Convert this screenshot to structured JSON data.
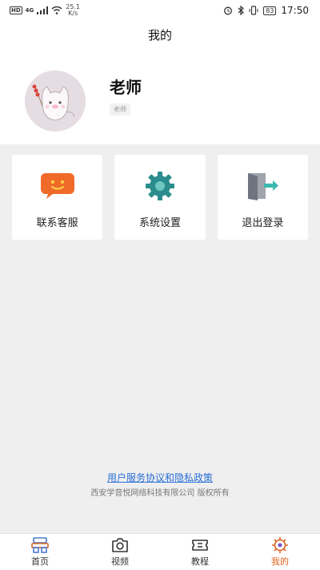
{
  "status_bar": {
    "hd": "HD",
    "network": "4G",
    "speed_value": "25.1",
    "speed_unit": "K/s",
    "battery": "83",
    "time": "17:50"
  },
  "header": {
    "title": "我的"
  },
  "profile": {
    "name": "老师",
    "role_tag": "老师"
  },
  "actions": [
    {
      "label": "联系客服",
      "icon": "customer-service-icon"
    },
    {
      "label": "系统设置",
      "icon": "gear-icon"
    },
    {
      "label": "退出登录",
      "icon": "logout-icon"
    }
  ],
  "footer": {
    "policy_link": "用户服务协议和隐私政策",
    "copyright": "西安学音悦网络科技有限公司 版权所有"
  },
  "tabbar": {
    "active": "我的",
    "items": [
      {
        "label": "首页",
        "icon": "home-icon"
      },
      {
        "label": "视频",
        "icon": "camera-icon"
      },
      {
        "label": "教程",
        "icon": "ticket-icon"
      },
      {
        "label": "我的",
        "icon": "profile-gear-icon"
      }
    ]
  },
  "colors": {
    "accent": "#e0641e",
    "link": "#2a6fd6",
    "gear": "#2a8c8c",
    "chat_bubble": "#f06a2a"
  }
}
